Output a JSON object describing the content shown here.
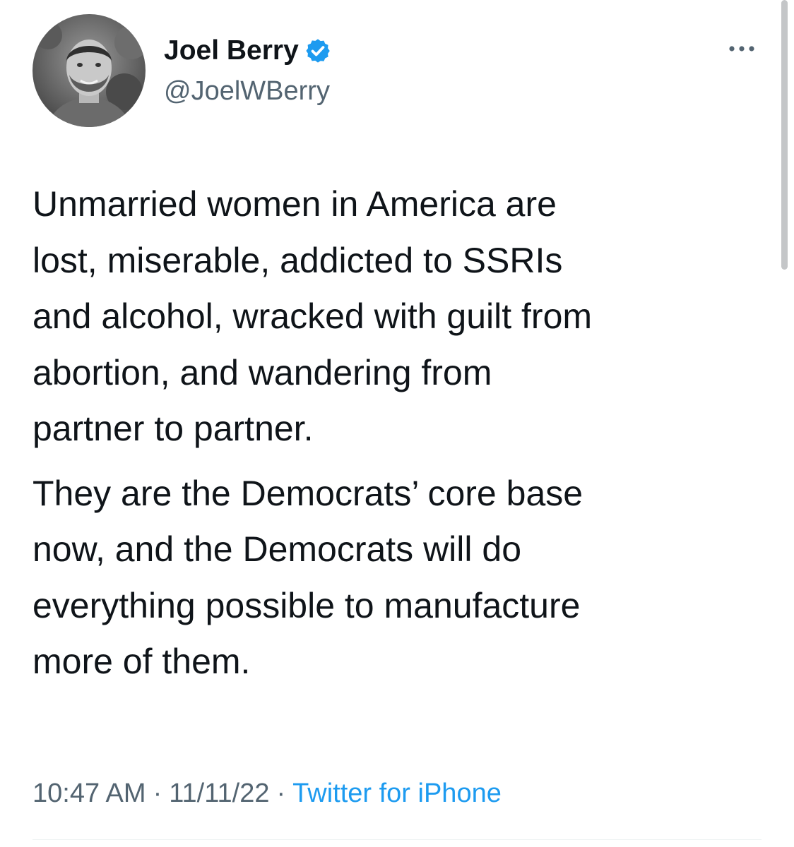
{
  "author": {
    "display_name": "Joel Berry",
    "handle": "@JoelWBerry",
    "verified": true,
    "avatar_icon": "user-avatar"
  },
  "tweet": {
    "paragraphs": [
      "Unmarried women in America are\nlost, miserable, addicted to SSRIs\nand alcohol, wracked with guilt from\nabortion, and wandering from\npartner to partner.",
      "They are the Democrats’ core base\nnow, and the Democrats will do\neverything possible to manufacture\nmore of them."
    ],
    "time": "10:47 AM",
    "date": "11/11/22",
    "separator": "·",
    "source": "Twitter for iPhone"
  },
  "colors": {
    "text": "#0f1419",
    "secondary": "#536471",
    "accent": "#1d9bf0",
    "verified_badge": "#1d9bf0"
  },
  "icons": {
    "more": "more-options-icon",
    "verified": "verified-badge-icon"
  }
}
